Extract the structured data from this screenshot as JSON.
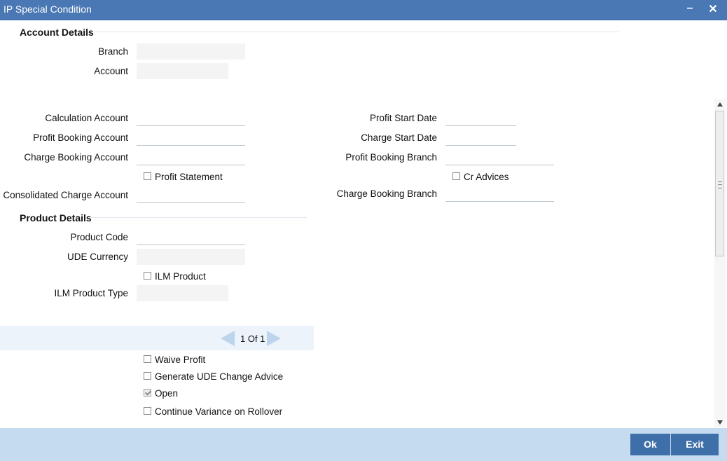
{
  "window": {
    "title": "IP Special Condition",
    "minimize_label": "–",
    "close_label": "✕"
  },
  "account_details": {
    "heading": "Account Details",
    "branch_label": "Branch",
    "branch_value": "",
    "account_label": "Account",
    "account_value": ""
  },
  "accounts": {
    "calculation_account_label": "Calculation Account",
    "profit_booking_account_label": "Profit Booking Account",
    "charge_booking_account_label": "Charge Booking Account",
    "profit_statement_label": "Profit Statement",
    "consolidated_charge_account_label": "Consolidated Charge Account",
    "profit_start_date_label": "Profit Start Date",
    "charge_start_date_label": "Charge Start Date",
    "profit_booking_branch_label": "Profit Booking Branch",
    "cr_advices_label": "Cr Advices",
    "charge_booking_branch_label": "Charge Booking Branch"
  },
  "product_details": {
    "heading": "Product Details",
    "product_code_label": "Product Code",
    "ude_currency_label": "UDE Currency",
    "ilm_product_label": "ILM Product",
    "ilm_product_type_label": "ILM Product Type"
  },
  "pager": {
    "text": "1 Of 1"
  },
  "options": {
    "waive_profit_label": "Waive Profit",
    "generate_ude_change_advice_label": "Generate UDE Change Advice",
    "open_label": "Open",
    "open_checked": true,
    "continue_variance_label": "Continue Variance on Rollover"
  },
  "footer": {
    "ok_label": "Ok",
    "exit_label": "Exit"
  },
  "colors": {
    "titlebar": "#4a78b4",
    "footer": "#c5dcf0",
    "button": "#3f6fa8"
  }
}
